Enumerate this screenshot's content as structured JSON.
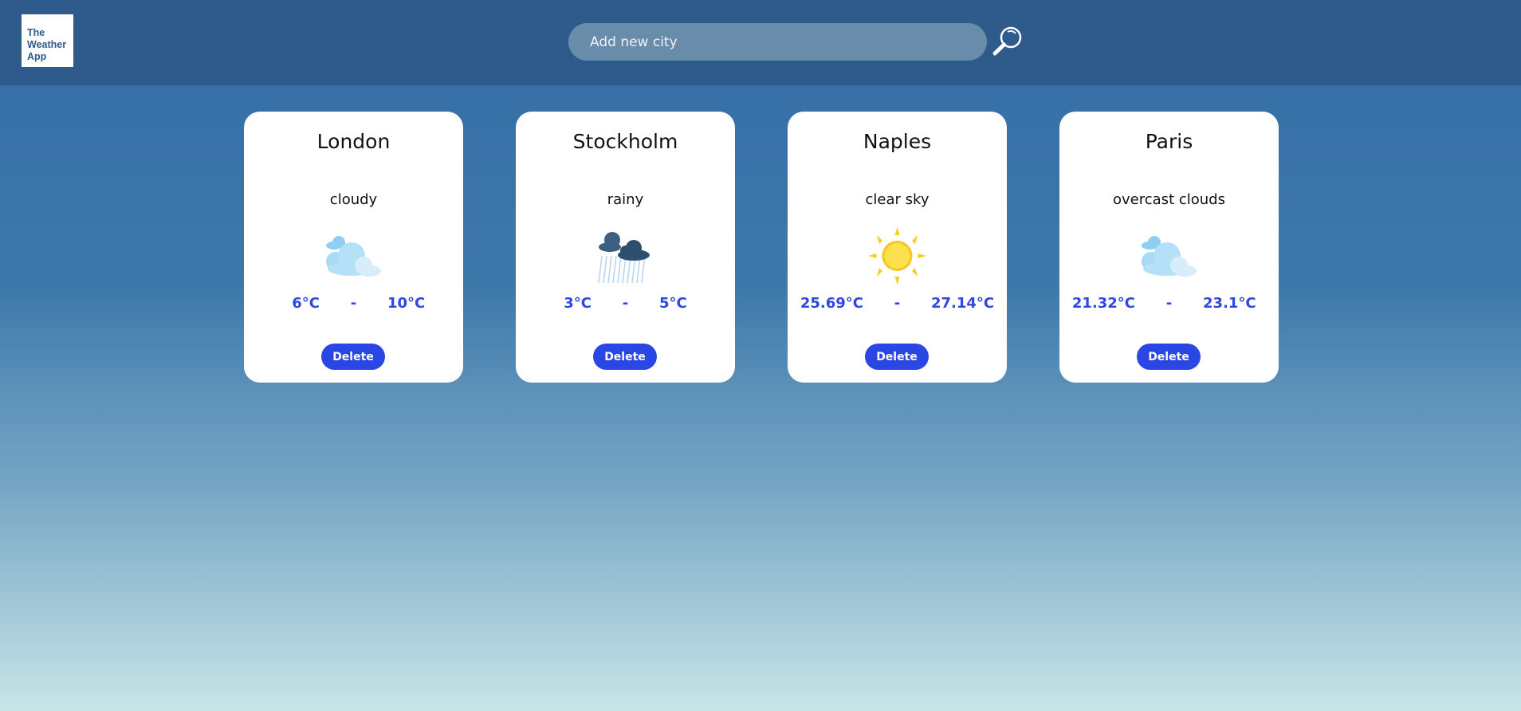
{
  "app": {
    "logo_lines": [
      "The",
      "Weather",
      "App"
    ]
  },
  "search": {
    "placeholder": "Add new city",
    "value": "",
    "icon": "search-icon"
  },
  "cards": [
    {
      "city": "London",
      "description": "cloudy",
      "icon": "cloud-icon",
      "min": "6°C",
      "separator": "-",
      "max": "10°C",
      "delete_label": "Delete"
    },
    {
      "city": "Stockholm",
      "description": "rainy",
      "icon": "rain-icon",
      "min": "3°C",
      "separator": "-",
      "max": "5°C",
      "delete_label": "Delete"
    },
    {
      "city": "Naples",
      "description": "clear sky",
      "icon": "sun-icon",
      "min": "25.69°C",
      "separator": "-",
      "max": "27.14°C",
      "delete_label": "Delete"
    },
    {
      "city": "Paris",
      "description": "overcast clouds",
      "icon": "cloud-icon",
      "min": "21.32°C",
      "separator": "-",
      "max": "23.1°C",
      "delete_label": "Delete"
    }
  ],
  "colors": {
    "header": "#2e5b8c",
    "accent": "#2a47e3",
    "temp_text": "#3047e0"
  }
}
